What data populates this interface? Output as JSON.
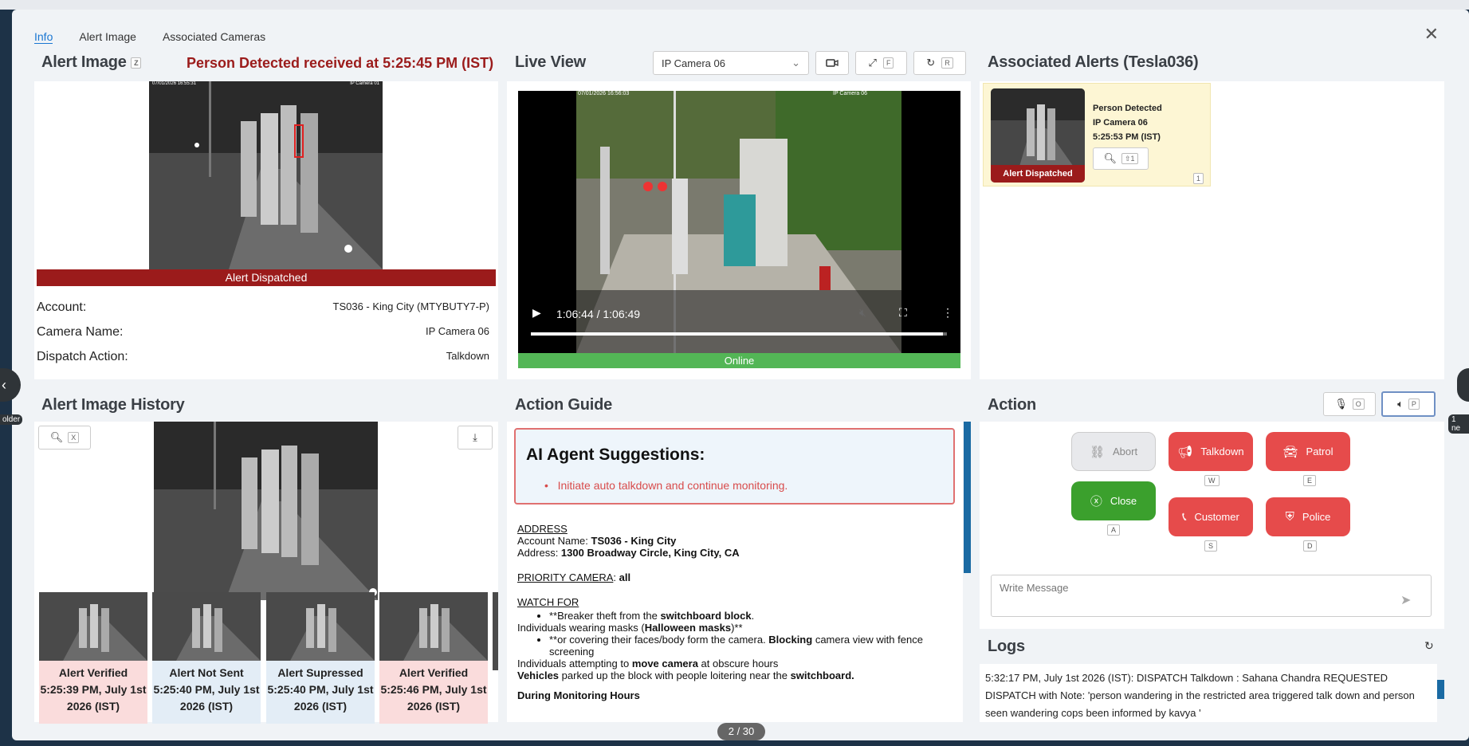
{
  "tabs": [
    "Info",
    "Alert Image",
    "Associated Cameras"
  ],
  "alert_image": {
    "title": "Alert Image",
    "hotkey": "Z",
    "received": "Person Detected received at 5:25:45 PM (IST)",
    "cam_stamp": "07/01/2026 16:55:31",
    "cam_label": "IP Camera 01",
    "banner": "Alert Dispatched",
    "details": [
      {
        "k": "Account:",
        "v": "TS036 - King City (MTYBUTY7-P)"
      },
      {
        "k": "Camera Name:",
        "v": "IP Camera 06"
      },
      {
        "k": "Dispatch Action:",
        "v": "Talkdown"
      }
    ]
  },
  "live_view": {
    "title": "Live View",
    "camera_select": "IP Camera 06",
    "hotkey_expand": "F",
    "hotkey_refresh": "R",
    "stamp": "07/01/2026 16:56:03",
    "cam_label": "IP Camera 06",
    "time": "1:06:44 / 1:06:49",
    "status": "Online",
    "progress": 0.99
  },
  "associated": {
    "title": "Associated Alerts (Tesla036)",
    "card": {
      "type": "Person Detected",
      "camera": "IP Camera 06",
      "time": "5:25:53 PM (IST)",
      "banner": "Alert Dispatched",
      "zoom_hk": "⇧1",
      "count": "1"
    }
  },
  "history": {
    "title": "Alert Image History",
    "zoom_hk": "X",
    "prev_label": "older",
    "next_label": "1 ne",
    "thumbs": [
      {
        "status": "Alert Verified",
        "time": "5:25:39 PM, July 1st 2026 (IST)",
        "bg": "#fadcdc"
      },
      {
        "status": "Alert Not Sent",
        "time": "5:25:40 PM, July 1st 2026 (IST)",
        "bg": "#e3edf6"
      },
      {
        "status": "Alert Supressed",
        "time": "5:25:40 PM, July 1st 2026 (IST)",
        "bg": "#e3edf6"
      },
      {
        "status": "Alert Verified",
        "time": "5:25:46 PM, July 1st 2026 (IST)",
        "bg": "#fadcdc"
      }
    ]
  },
  "guide": {
    "title": "Action Guide",
    "ai_title": "AI Agent Suggestions:",
    "ai_item": "Initiate auto talkdown and continue monitoring.",
    "address_h": "ADDRESS",
    "account_lbl": "Account Name: ",
    "account": "TS036 - King City",
    "address_lbl": "Address: ",
    "address": "1300 Broadway Circle, King City, CA",
    "priority_h": "PRIORITY CAMERA",
    "priority": "all",
    "watch_h": "WATCH FOR",
    "w1a": "**Breaker theft from the ",
    "w1b": "switchboard block",
    "w2a": "Individuals wearing masks (",
    "w2b": "Halloween masks",
    "w2c": ")**",
    "w3a": "**or covering their faces/body form the camera. ",
    "w3b": "Blocking",
    "w3c": " camera view with fence screening",
    "w4a": "Individuals attempting to ",
    "w4b": "move camera",
    "w4c": " at obscure hours",
    "w5a": "Vehicles",
    "w5b": " parked up the block with people loitering near the ",
    "w5c": "switchboard.",
    "monitor_h": "During Monitoring Hours",
    "pager": "2 / 30"
  },
  "action": {
    "title": "Action",
    "mic_hk": "O",
    "spk_hk": "P",
    "buttons": {
      "abort": "Abort",
      "talkdown": "Talkdown",
      "patrol": "Patrol",
      "close": "Close",
      "customer": "Customer",
      "police": "Police"
    },
    "hotkeys": {
      "talkdown": "W",
      "patrol": "E",
      "close": "A",
      "customer": "S",
      "police": "D"
    },
    "message_placeholder": "Write Message"
  },
  "logs": {
    "title": "Logs",
    "entry": "5:32:17 PM, July 1st 2026 (IST): DISPATCH Talkdown : Sahana Chandra REQUESTED DISPATCH with Note: 'person wandering in the restricted area triggered talk down and person seen wandering cops been informed by kavya '"
  },
  "colors": {
    "accent": "#1976d2",
    "dark_red": "#9b1b1b",
    "red": "#e64b4b",
    "green": "#3ba02d",
    "online": "#53b656"
  }
}
